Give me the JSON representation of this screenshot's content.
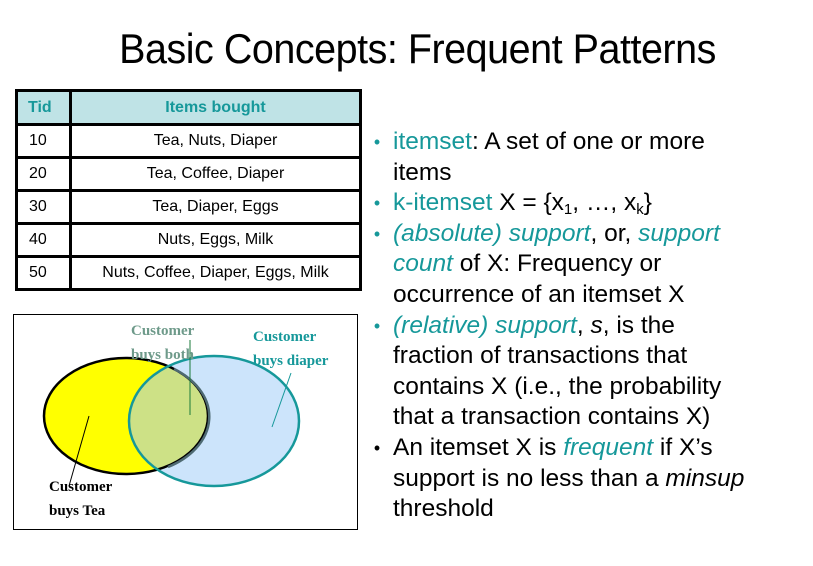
{
  "title": "Basic Concepts: Frequent Patterns",
  "colors": {
    "accent_teal": "#16989a",
    "table_header_bg": "#bfe3e6",
    "venn_tea_fill": "#ffff00",
    "venn_diaper_fill": "#cce4fb",
    "venn_overlap_fill": "#cde186",
    "venn_both_label": "#6e9a8a"
  },
  "table": {
    "headers": [
      "Tid",
      "Items bought"
    ],
    "rows": [
      {
        "tid": "10",
        "items": "Tea, Nuts, Diaper"
      },
      {
        "tid": "20",
        "items": "Tea, Coffee, Diaper"
      },
      {
        "tid": "30",
        "items": "Tea, Diaper, Eggs"
      },
      {
        "tid": "40",
        "items": "Nuts, Eggs, Milk"
      },
      {
        "tid": "50",
        "items": "Nuts, Coffee, Diaper, Eggs, Milk"
      }
    ]
  },
  "venn": {
    "both_label": [
      "Customer",
      "buys both"
    ],
    "diaper_label": [
      "Customer",
      "buys diaper"
    ],
    "tea_label": [
      "Customer",
      "buys Tea"
    ]
  },
  "bullets": {
    "b1": {
      "term": "itemset",
      "rest_line1": ": A set of one or more",
      "rest_line2": "items"
    },
    "b2": {
      "term": "k-itemset",
      "rest": " X = {x",
      "sub1": "1",
      "mid": ", …, x",
      "subk": "k",
      "end": "}"
    },
    "b3": {
      "term1": "(absolute) support",
      "mid": ", or, ",
      "term2a": "support",
      "term2b": "count",
      "rest_line2": " of X: Frequency or",
      "line3": "occurrence of an itemset X"
    },
    "b4": {
      "term": "(relative) support",
      "mid1": ", ",
      "s": "s",
      "rest1": ", is the",
      "line2": "fraction of transactions that",
      "line3": "contains X (i.e., the probability",
      "line4": "that a transaction contains X)"
    },
    "b5": {
      "pre": "An itemset X is ",
      "term": "frequent",
      "post": " if X’s",
      "line2_pre": "support is no less than a ",
      "minsup": "minsup",
      "line3": "threshold"
    }
  }
}
